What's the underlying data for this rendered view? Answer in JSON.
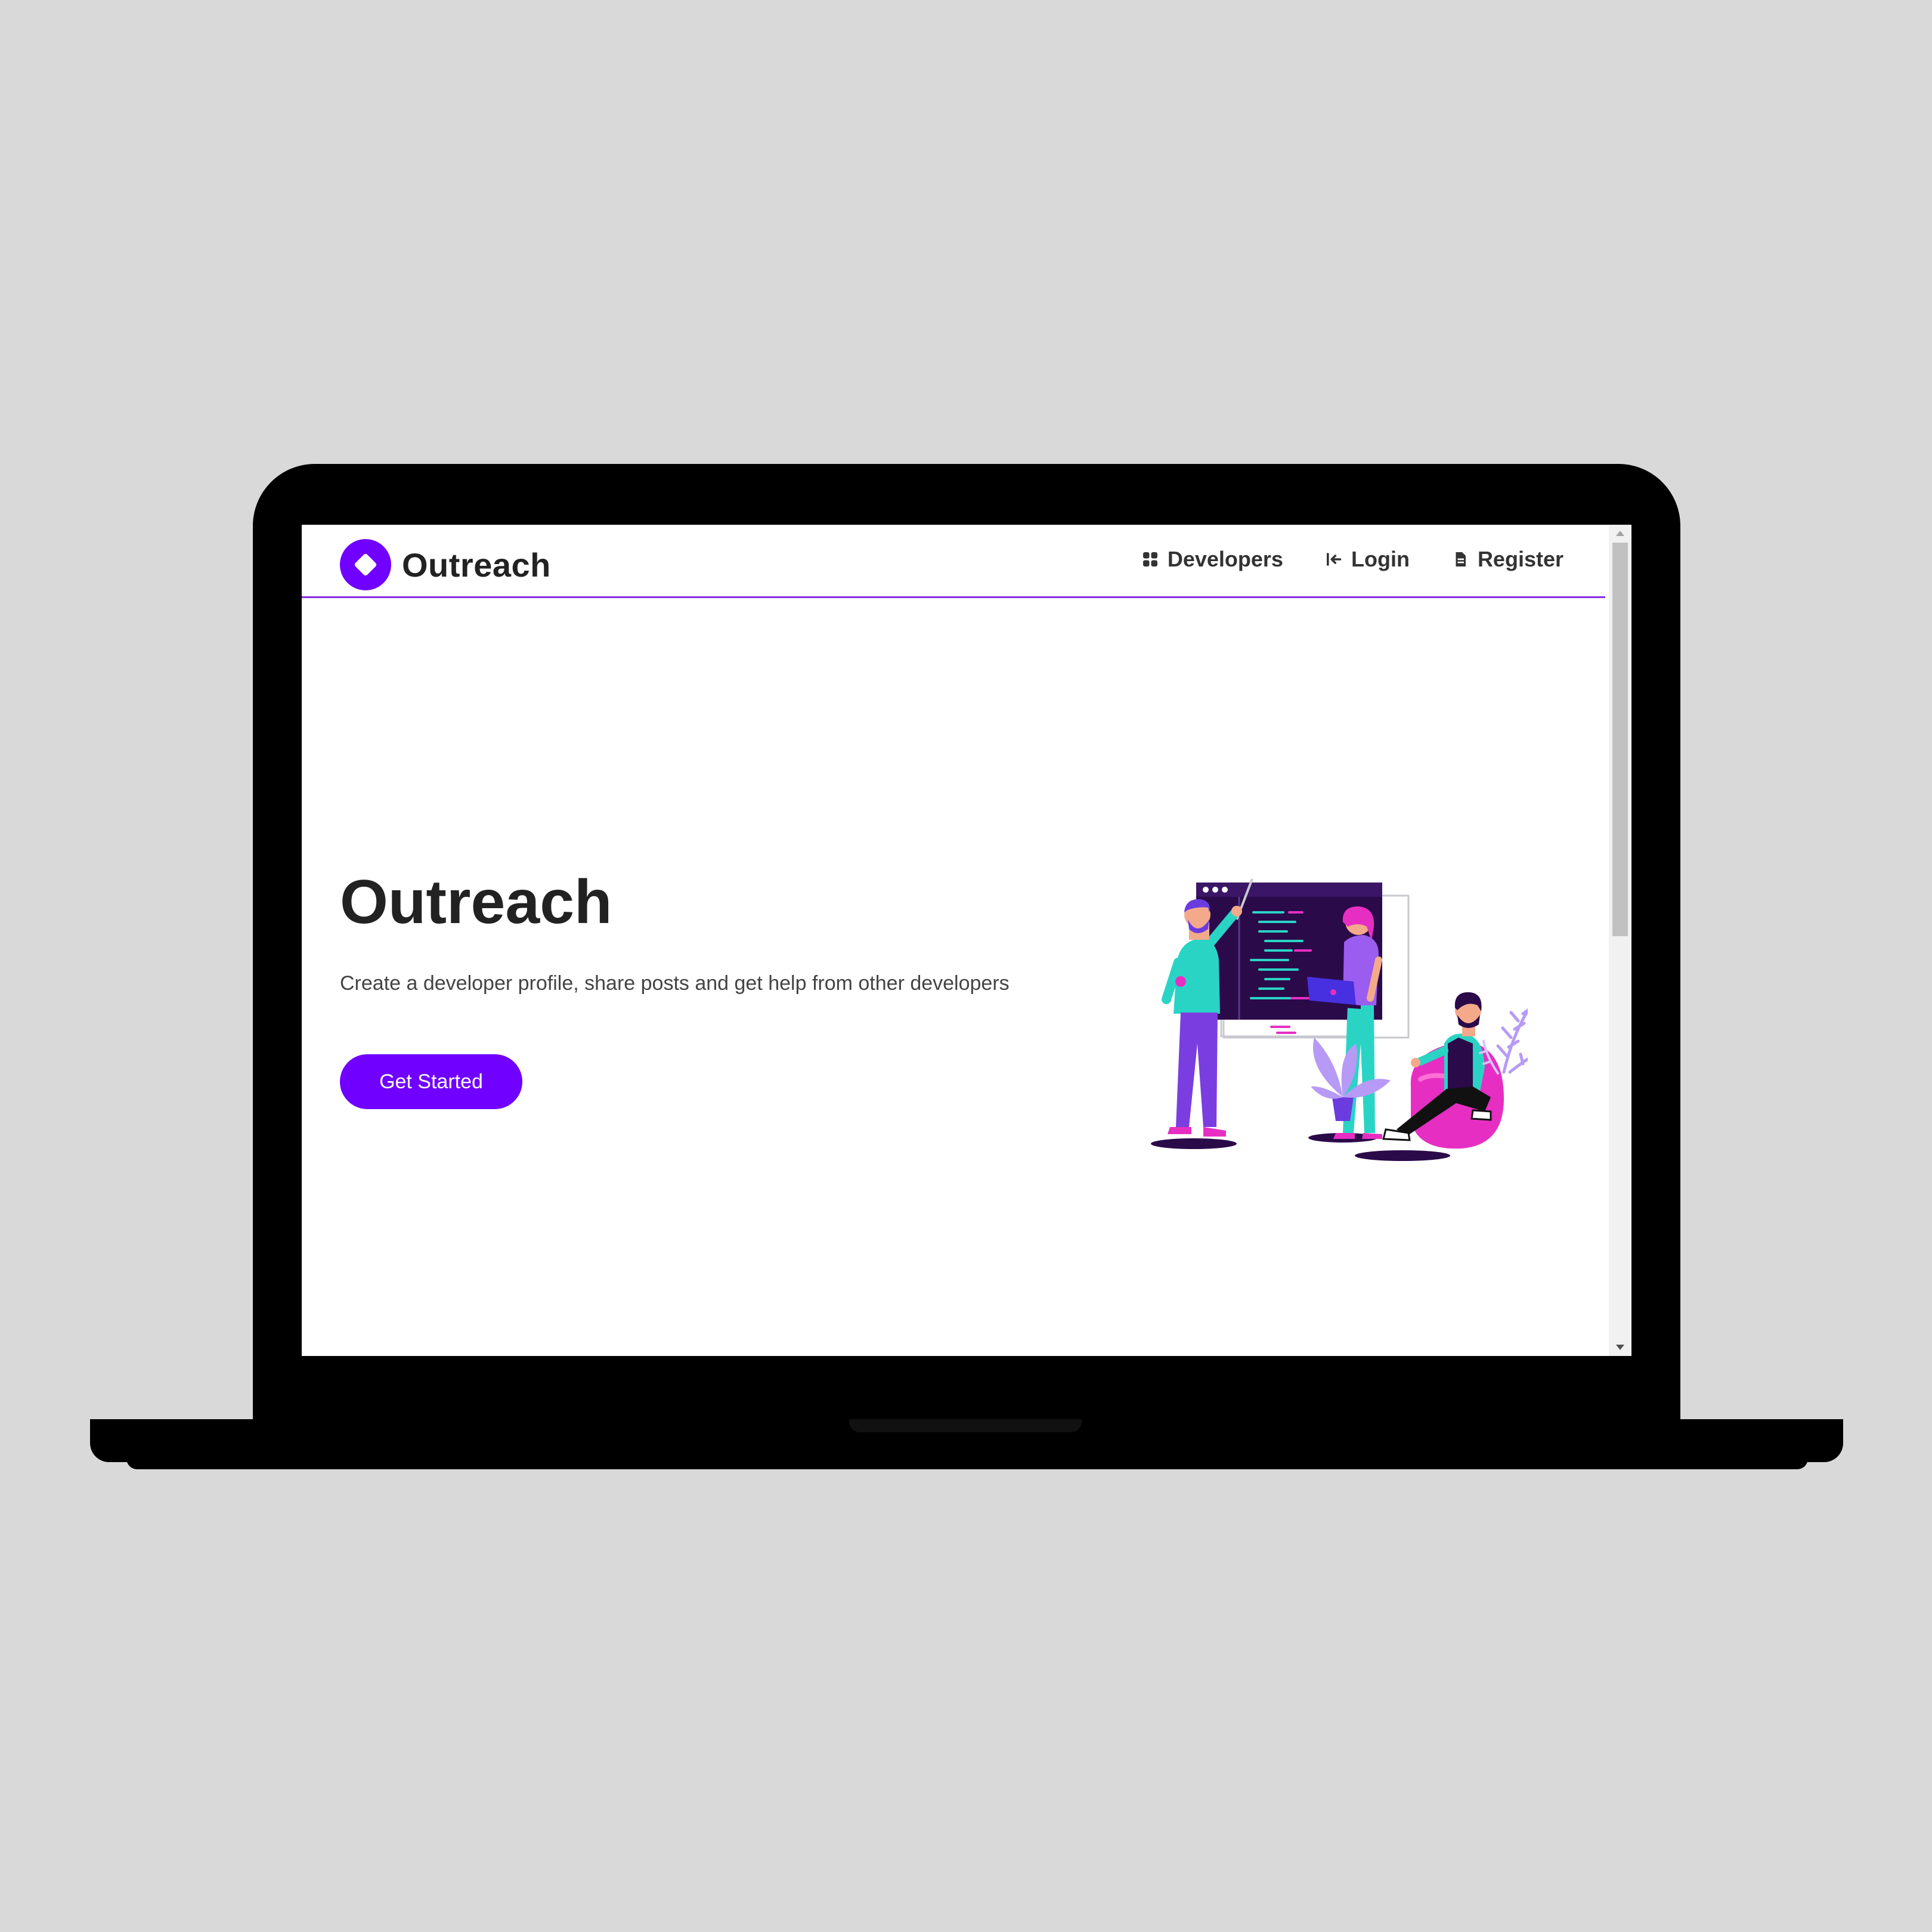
{
  "navbar": {
    "brand": "Outreach",
    "links": [
      {
        "label": "Developers",
        "icon": "grid-icon"
      },
      {
        "label": "Login",
        "icon": "sign-in-icon"
      },
      {
        "label": "Register",
        "icon": "document-icon"
      }
    ]
  },
  "hero": {
    "title": "Outreach",
    "subtitle": "Create a developer profile, share posts and get help from other developers",
    "cta_label": "Get Started"
  },
  "colors": {
    "accent": "#7000ff",
    "divider": "#8a2be2",
    "teal": "#2ad4c5",
    "pink": "#e62fc2",
    "dark_purple": "#2b0a4a"
  }
}
